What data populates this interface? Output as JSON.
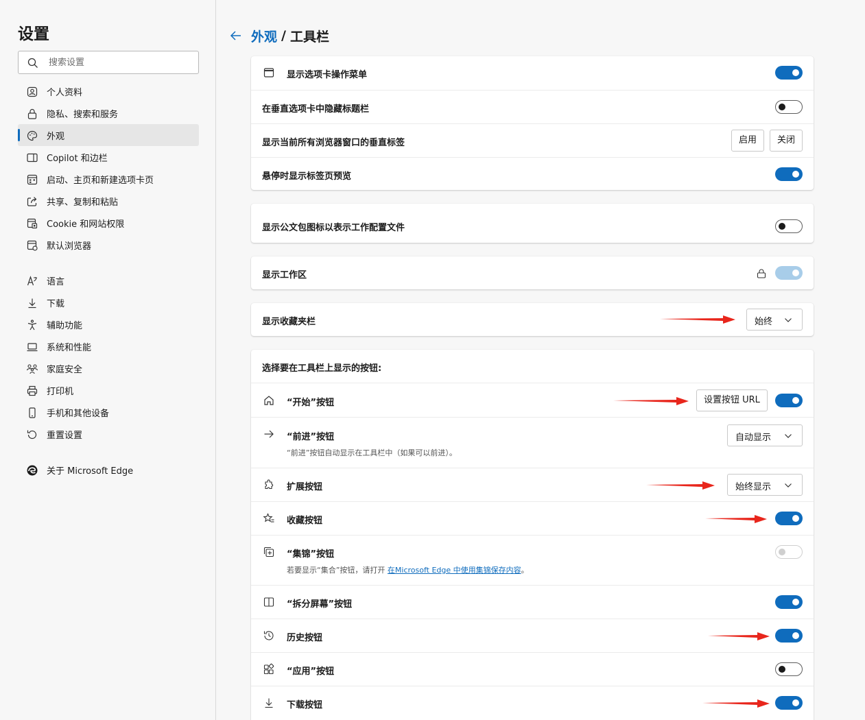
{
  "sidebar": {
    "title": "设置",
    "search_placeholder": "搜索设置",
    "items": [
      {
        "label": "个人资料",
        "icon": "profile-icon"
      },
      {
        "label": "隐私、搜索和服务",
        "icon": "lock-icon"
      },
      {
        "label": "外观",
        "icon": "palette-icon",
        "active": true
      },
      {
        "label": "Copilot 和边栏",
        "icon": "sidebar-icon"
      },
      {
        "label": "启动、主页和新建选项卡页",
        "icon": "home-grid-icon"
      },
      {
        "label": "共享、复制和粘贴",
        "icon": "share-icon"
      },
      {
        "label": "Cookie 和网站权限",
        "icon": "cookie-permissions-icon"
      },
      {
        "label": "默认浏览器",
        "icon": "browser-icon"
      },
      {
        "label": "语言",
        "icon": "language-icon"
      },
      {
        "label": "下载",
        "icon": "download-icon"
      },
      {
        "label": "辅助功能",
        "icon": "accessibility-icon"
      },
      {
        "label": "系统和性能",
        "icon": "system-icon"
      },
      {
        "label": "家庭安全",
        "icon": "family-icon"
      },
      {
        "label": "打印机",
        "icon": "printer-icon"
      },
      {
        "label": "手机和其他设备",
        "icon": "phone-icon"
      },
      {
        "label": "重置设置",
        "icon": "reset-icon"
      },
      {
        "label": "关于 Microsoft Edge",
        "icon": "edge-logo-icon"
      }
    ]
  },
  "breadcrumb": {
    "parent": "外观",
    "separator": "/",
    "current": "工具栏"
  },
  "group1": {
    "rows": [
      {
        "label": "显示选项卡操作菜单",
        "toggle": "on"
      },
      {
        "label": "在垂直选项卡中隐藏标题栏",
        "toggle": "off"
      },
      {
        "label": "显示当前所有浏览器窗口的垂直标签",
        "enable_label": "启用",
        "disable_label": "关闭"
      },
      {
        "label": "悬停时显示标签页预览",
        "toggle": "on"
      }
    ]
  },
  "group2": {
    "label": "显示公文包图标以表示工作配置文件",
    "toggle": "off"
  },
  "group3": {
    "label": "显示工作区",
    "toggle": "disabled-on",
    "locked": true
  },
  "group4": {
    "label": "显示收藏夹栏",
    "value": "始终"
  },
  "toolbar_buttons": {
    "header": "选择要在工具栏上显示的按钮:",
    "home": {
      "label": "“开始”按钮",
      "button_label": "设置按钮 URL",
      "toggle": "on"
    },
    "forward": {
      "label": "“前进”按钮",
      "desc": "“前进”按钮自动显示在工具栏中（如果可以前进）。",
      "value": "自动显示"
    },
    "extensions": {
      "label": "扩展按钮",
      "value": "始终显示"
    },
    "favorites": {
      "label": "收藏按钮",
      "toggle": "on"
    },
    "collections": {
      "label": "“集锦”按钮",
      "desc_prefix": "若要显示“集合”按钮，请打开 ",
      "desc_link": "在Microsoft Edge 中使用集锦保存内容",
      "desc_suffix": "。",
      "toggle": "disabled-off"
    },
    "split": {
      "label": "“拆分屏幕”按钮",
      "toggle": "on"
    },
    "history": {
      "label": "历史按钮",
      "toggle": "on"
    },
    "apps": {
      "label": "“应用”按钮",
      "toggle": "off"
    },
    "downloads": {
      "label": "下载按钮",
      "toggle": "on"
    }
  },
  "colors": {
    "accent": "#0f6cbd",
    "annotation_arrow": "#e8261c"
  }
}
